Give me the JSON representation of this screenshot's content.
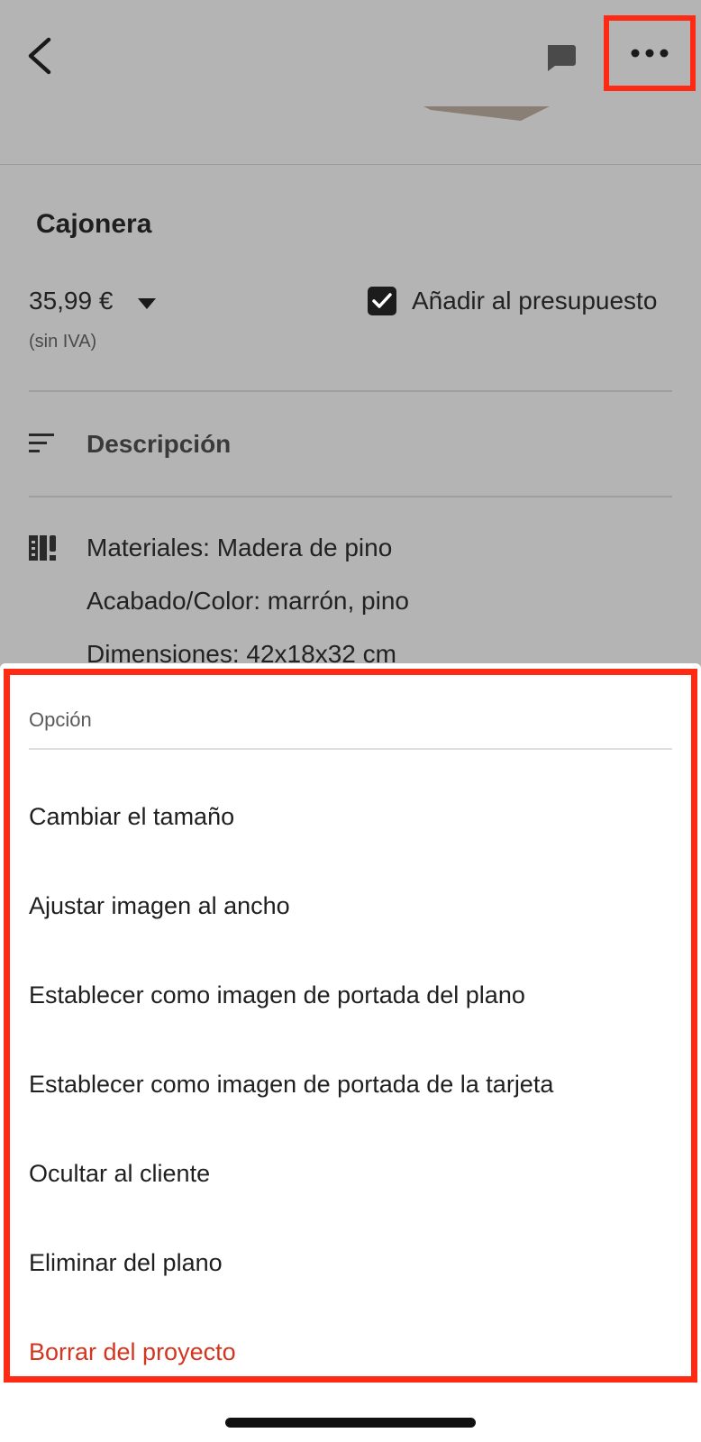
{
  "header": {
    "back_icon": "chevron-left-icon",
    "chat_icon": "chat-bubble-icon",
    "more_icon": "more-horizontal-icon"
  },
  "product": {
    "title": "Cajonera",
    "price": "35,99 €",
    "price_note": "(sin IVA)",
    "budget_label": "Añadir al presupuesto",
    "budget_checked": true,
    "description_label": "Descripción",
    "specs": [
      "Materiales: Madera de pino",
      "Acabado/Color: marrón, pino",
      "Dimensiones: 42x18x32 cm"
    ]
  },
  "sheet": {
    "header": "Opción",
    "items": [
      {
        "label": "Cambiar el tamaño"
      },
      {
        "label": "Ajustar imagen al ancho"
      },
      {
        "label": "Establecer como imagen de portada del plano"
      },
      {
        "label": "Establecer como imagen de portada de la tarjeta"
      },
      {
        "label": "Ocultar al cliente"
      },
      {
        "label": "Eliminar del plano"
      },
      {
        "label": "Borrar del proyecto"
      }
    ]
  },
  "colors": {
    "highlight": "#ff2a14",
    "danger_text": "#d3351f",
    "dim_background": "#b4b4b4"
  }
}
